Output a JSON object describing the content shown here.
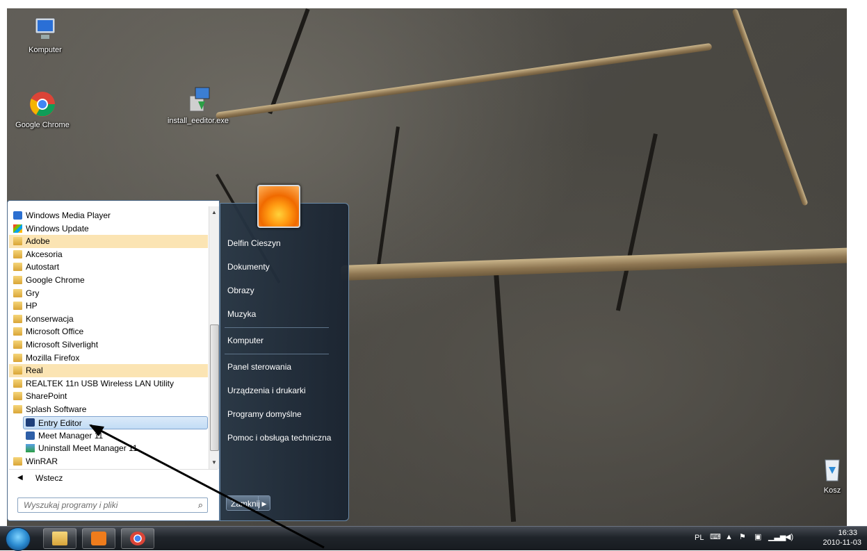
{
  "desktop": {
    "icons": [
      {
        "label": "Komputer",
        "icon": "computer-icon"
      },
      {
        "label": "Google Chrome",
        "icon": "chrome-icon"
      },
      {
        "label": "install_eeditor.exe",
        "icon": "installer-icon"
      },
      {
        "label": "Kosz",
        "icon": "recycle-bin-icon"
      }
    ]
  },
  "start_menu": {
    "programs": [
      {
        "label": "Windows Media Player",
        "icon": "media-player-icon"
      },
      {
        "label": "Windows Update",
        "icon": "windows-update-icon"
      },
      {
        "label": "Adobe",
        "icon": "folder-icon"
      },
      {
        "label": "Akcesoria",
        "icon": "folder-icon"
      },
      {
        "label": "Autostart",
        "icon": "folder-icon"
      },
      {
        "label": "Google Chrome",
        "icon": "folder-icon"
      },
      {
        "label": "Gry",
        "icon": "folder-icon"
      },
      {
        "label": "HP",
        "icon": "folder-icon"
      },
      {
        "label": "Konserwacja",
        "icon": "folder-icon"
      },
      {
        "label": "Microsoft Office",
        "icon": "folder-icon"
      },
      {
        "label": "Microsoft Silverlight",
        "icon": "folder-icon"
      },
      {
        "label": "Mozilla Firefox",
        "icon": "folder-icon"
      },
      {
        "label": "Real",
        "icon": "folder-icon"
      },
      {
        "label": "REALTEK 11n USB Wireless LAN Utility",
        "icon": "folder-icon"
      },
      {
        "label": "SharePoint",
        "icon": "folder-icon"
      },
      {
        "label": "Splash Software",
        "icon": "folder-icon"
      },
      {
        "label": "Entry Editor",
        "icon": "entry-editor-icon"
      },
      {
        "label": "Meet Manager 11",
        "icon": "meet-manager-icon"
      },
      {
        "label": "Uninstall Meet Manager 11",
        "icon": "uninstall-icon"
      },
      {
        "label": "WinRAR",
        "icon": "folder-icon"
      }
    ],
    "back_label": "Wstecz",
    "search_placeholder": "Wyszukaj programy i pliki",
    "places": [
      "Delfin Cieszyn",
      "Dokumenty",
      "Obrazy",
      "Muzyka",
      "Komputer",
      "Panel sterowania",
      "Urządzenia i drukarki",
      "Programy domyślne",
      "Pomoc i obsługa techniczna"
    ],
    "shutdown_label": "Zamknij"
  },
  "taskbar": {
    "pinned": [
      "explorer-icon",
      "media-player-icon",
      "chrome-icon"
    ],
    "language": "PL",
    "time": "16:33",
    "date": "2010-11-03"
  }
}
